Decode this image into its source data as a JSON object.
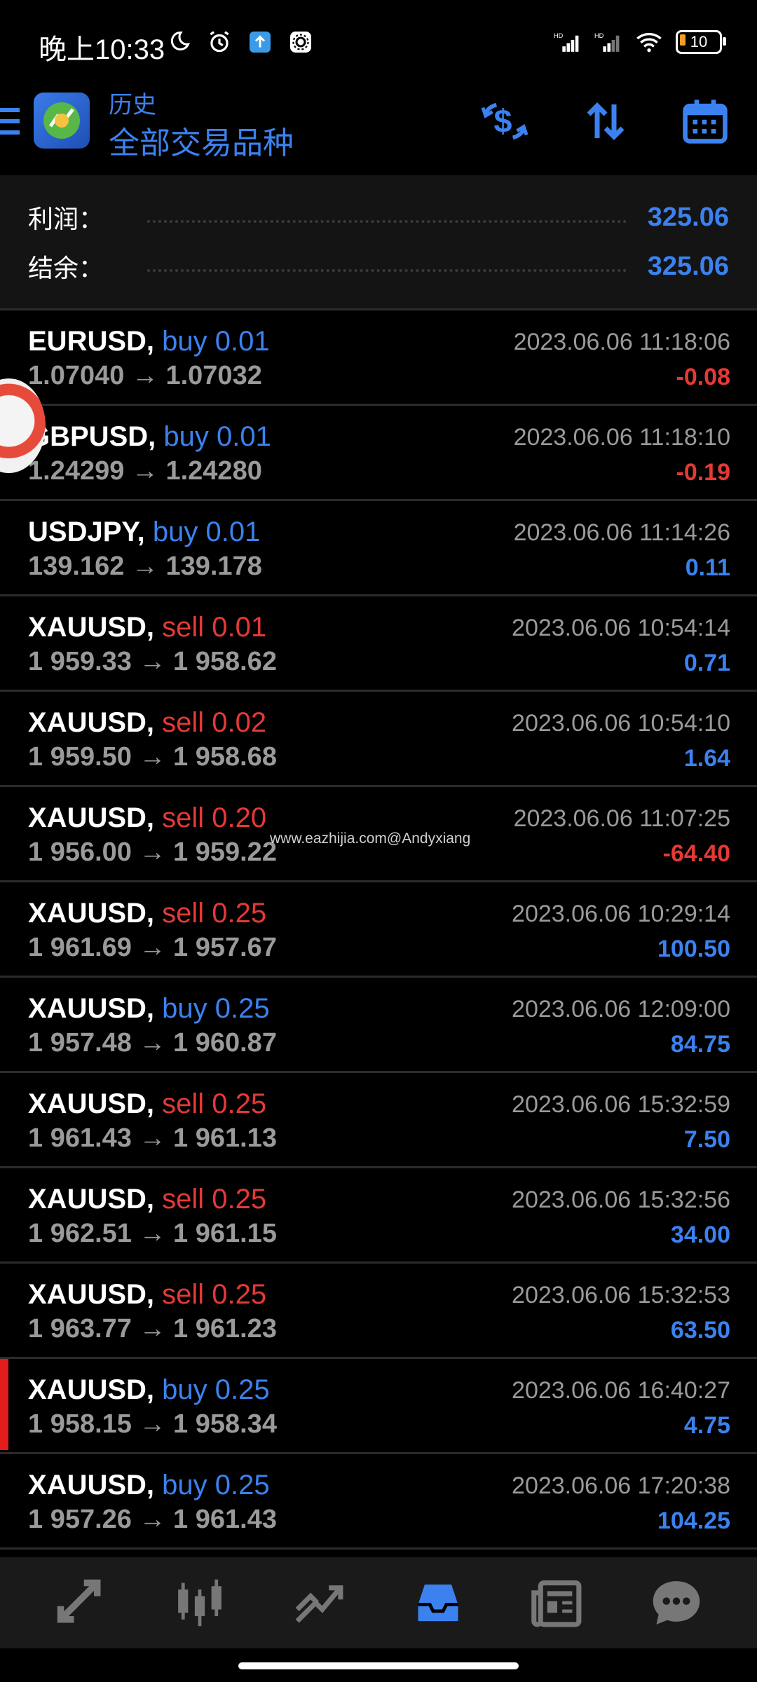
{
  "status_bar": {
    "time": "晚上10:33",
    "battery": "10",
    "network1": "HD",
    "network2": "HD"
  },
  "header": {
    "subtitle": "历史",
    "title": "全部交易品种"
  },
  "summary": {
    "profit_label": "利润：",
    "profit_value": "325.06",
    "balance_label": "结余：",
    "balance_value": "325.06"
  },
  "watermark": "www.eazhijia.com@Andyxiang",
  "trades": [
    {
      "symbol": "EURUSD,",
      "side": "buy 0.01",
      "type": "buy",
      "prices": "1.07040 → 1.07032",
      "date": "2023.06.06 11:18:06",
      "pnl": "-0.08",
      "pnl_sign": "neg"
    },
    {
      "symbol": "GBPUSD,",
      "side": "buy 0.01",
      "type": "buy",
      "prices": "1.24299 → 1.24280",
      "date": "2023.06.06 11:18:10",
      "pnl": "-0.19",
      "pnl_sign": "neg"
    },
    {
      "symbol": "USDJPY,",
      "side": "buy 0.01",
      "type": "buy",
      "prices": "139.162 → 139.178",
      "date": "2023.06.06 11:14:26",
      "pnl": "0.11",
      "pnl_sign": "pos"
    },
    {
      "symbol": "XAUUSD,",
      "side": "sell 0.01",
      "type": "sell",
      "prices": "1 959.33 → 1 958.62",
      "date": "2023.06.06 10:54:14",
      "pnl": "0.71",
      "pnl_sign": "pos"
    },
    {
      "symbol": "XAUUSD,",
      "side": "sell 0.02",
      "type": "sell",
      "prices": "1 959.50 → 1 958.68",
      "date": "2023.06.06 10:54:10",
      "pnl": "1.64",
      "pnl_sign": "pos"
    },
    {
      "symbol": "XAUUSD,",
      "side": "sell 0.20",
      "type": "sell",
      "prices": "1 956.00 → 1 959.22",
      "date": "2023.06.06 11:07:25",
      "pnl": "-64.40",
      "pnl_sign": "neg"
    },
    {
      "symbol": "XAUUSD,",
      "side": "sell 0.25",
      "type": "sell",
      "prices": "1 961.69 → 1 957.67",
      "date": "2023.06.06 10:29:14",
      "pnl": "100.50",
      "pnl_sign": "pos"
    },
    {
      "symbol": "XAUUSD,",
      "side": "buy 0.25",
      "type": "buy",
      "prices": "1 957.48 → 1 960.87",
      "date": "2023.06.06 12:09:00",
      "pnl": "84.75",
      "pnl_sign": "pos"
    },
    {
      "symbol": "XAUUSD,",
      "side": "sell 0.25",
      "type": "sell",
      "prices": "1 961.43 → 1 961.13",
      "date": "2023.06.06 15:32:59",
      "pnl": "7.50",
      "pnl_sign": "pos"
    },
    {
      "symbol": "XAUUSD,",
      "side": "sell 0.25",
      "type": "sell",
      "prices": "1 962.51 → 1 961.15",
      "date": "2023.06.06 15:32:56",
      "pnl": "34.00",
      "pnl_sign": "pos"
    },
    {
      "symbol": "XAUUSD,",
      "side": "sell 0.25",
      "type": "sell",
      "prices": "1 963.77 → 1 961.23",
      "date": "2023.06.06 15:32:53",
      "pnl": "63.50",
      "pnl_sign": "pos"
    },
    {
      "symbol": "XAUUSD,",
      "side": "buy 0.25",
      "type": "buy",
      "prices": "1 958.15 → 1 958.34",
      "date": "2023.06.06 16:40:27",
      "pnl": "4.75",
      "pnl_sign": "pos",
      "selected": true
    },
    {
      "symbol": "XAUUSD,",
      "side": "buy 0.25",
      "type": "buy",
      "prices": "1 957.26 → 1 961.43",
      "date": "2023.06.06 17:20:38",
      "pnl": "104.25",
      "pnl_sign": "pos"
    }
  ],
  "colors": {
    "accent": "#3b82f0",
    "loss": "#e53935",
    "background": "#000000",
    "panel": "#141414"
  },
  "bottom_nav": [
    {
      "icon": "quotes-icon",
      "active": false
    },
    {
      "icon": "chart-icon",
      "active": false
    },
    {
      "icon": "trade-icon",
      "active": false
    },
    {
      "icon": "history-icon",
      "active": true
    },
    {
      "icon": "news-icon",
      "active": false
    },
    {
      "icon": "chat-icon",
      "active": false
    }
  ]
}
